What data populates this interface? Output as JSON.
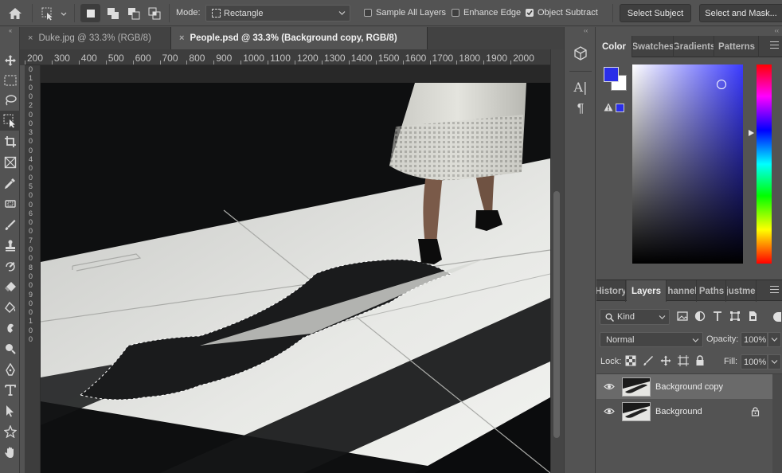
{
  "options_bar": {
    "mode_label": "Mode:",
    "mode_value": "Rectangle",
    "sample_all_layers": {
      "label": "Sample All Layers",
      "checked": false
    },
    "enhance_edge": {
      "label": "Enhance Edge",
      "checked": false
    },
    "object_subtract": {
      "label": "Object Subtract",
      "checked": true
    },
    "select_subject_label": "Select Subject",
    "select_and_mask_label": "Select and Mask..."
  },
  "tools": [
    "move-tool-icon",
    "marquee-tool-icon",
    "lasso-tool-icon",
    "object-selection-tool-icon",
    "crop-tool-icon",
    "frame-tool-icon",
    "eyedropper-tool-icon",
    "patch-tool-icon",
    "brush-tool-icon",
    "stamp-tool-icon",
    "history-brush-tool-icon",
    "eraser-tool-icon",
    "paint-bucket-tool-icon",
    "smudge-tool-icon",
    "dodge-tool-icon",
    "pen-tool-icon",
    "type-tool-icon",
    "path-selection-tool-icon",
    "custom-shape-tool-icon",
    "hand-tool-icon"
  ],
  "tabs": [
    {
      "label": "Duke.jpg @ 33.3% (RGB/8)",
      "close": "×"
    },
    {
      "label": "People.psd @ 33.3% (Background copy, RGB/8)",
      "close": "×"
    }
  ],
  "ruler": {
    "h_ticks": [
      "200",
      "300",
      "400",
      "500",
      "600",
      "700",
      "800",
      "900",
      "1000",
      "1100",
      "1200",
      "1300",
      "1400",
      "1500",
      "1600",
      "1700",
      "1800",
      "1900",
      "2000"
    ],
    "v_ticks": [
      "0",
      "1",
      "0",
      "0",
      "2",
      "0",
      "0",
      "3",
      "0",
      "0",
      "4",
      "0",
      "0",
      "5",
      "0",
      "0",
      "6",
      "0",
      "0",
      "7",
      "0",
      "0",
      "8",
      "0",
      "0",
      "9",
      "0",
      "0",
      "1",
      "0",
      "0"
    ]
  },
  "color_panel": {
    "tabs": [
      "Color",
      "Swatches",
      "Gradients",
      "Patterns"
    ],
    "foreground": "#2a2ee8",
    "background": "#ffffff",
    "hue_color": "#3b3bff"
  },
  "layers_panel": {
    "tabs": [
      "History",
      "Layers",
      "Channels",
      "Paths",
      "Adjustments"
    ],
    "kind_label": "Kind",
    "blend_mode": "Normal",
    "opacity_label": "Opacity:",
    "opacity_value": "100%",
    "lock_label": "Lock:",
    "fill_label": "Fill:",
    "fill_value": "100%",
    "layers": [
      {
        "name": "Background copy",
        "selected": true,
        "locked": false
      },
      {
        "name": "Background",
        "selected": false,
        "locked": true
      }
    ]
  },
  "middle_dock": {
    "char_panel_icon": "A|",
    "para_panel_icon": "¶"
  },
  "collapse_glyph": "‹‹"
}
